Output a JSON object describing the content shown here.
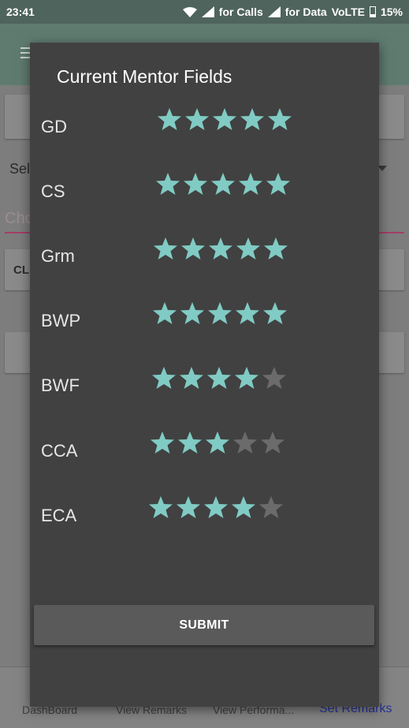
{
  "status_bar": {
    "time": "23:41",
    "calls_label": "for Calls",
    "data_label": "for Data",
    "network": "VoLTE",
    "battery": "15%"
  },
  "background": {
    "select_text": "Sel",
    "hint_text": "Cho",
    "card_text": "CL"
  },
  "bottom_nav": {
    "items": [
      "DashBoard",
      "View Remarks",
      "View Performa...",
      "Set Remarks"
    ],
    "active_index": 3
  },
  "dialog": {
    "title": "Current Mentor Fields",
    "fields": [
      {
        "label": "GD",
        "rating": 5,
        "max": 5
      },
      {
        "label": "CS",
        "rating": 5,
        "max": 5
      },
      {
        "label": "Grm",
        "rating": 5,
        "max": 5
      },
      {
        "label": "BWP",
        "rating": 5,
        "max": 5
      },
      {
        "label": "BWF",
        "rating": 4,
        "max": 5
      },
      {
        "label": "CCA",
        "rating": 3,
        "max": 5
      },
      {
        "label": "ECA",
        "rating": 4,
        "max": 5
      }
    ],
    "submit_label": "SUBMIT"
  },
  "colors": {
    "star_filled": "#80cbc4",
    "star_empty": "#6b6b6b",
    "dialog_bg": "#414141",
    "status_bar": "#4f645c"
  }
}
